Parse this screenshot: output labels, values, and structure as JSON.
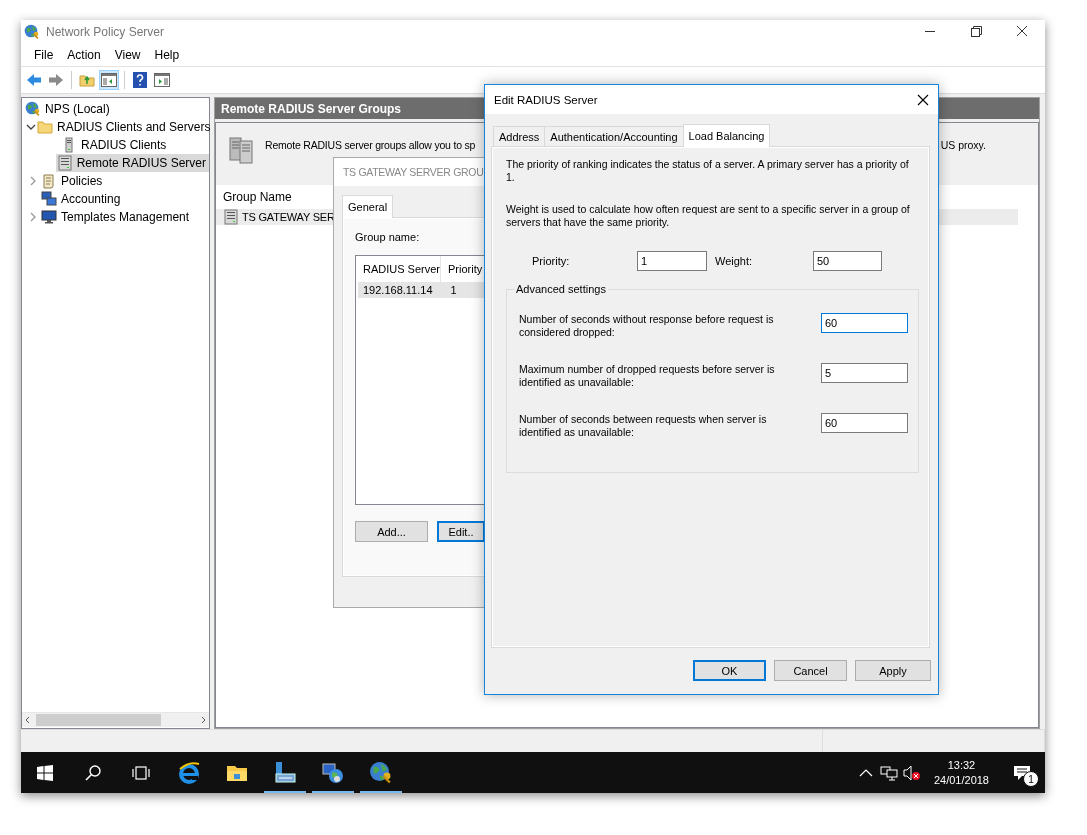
{
  "window": {
    "title": "Network Policy Server"
  },
  "menu": [
    "File",
    "Action",
    "View",
    "Help"
  ],
  "toolbar": {
    "console_tree_on": true
  },
  "tree": [
    {
      "label": "NPS (Local)",
      "kind": "root",
      "selected": false,
      "children": [
        {
          "label": "RADIUS Clients and Servers",
          "kind": "folder",
          "selected": false,
          "expanded": true,
          "children": [
            {
              "label": "RADIUS Clients",
              "kind": "client",
              "selected": false
            },
            {
              "label": "Remote RADIUS Server",
              "kind": "group",
              "selected": true
            }
          ]
        },
        {
          "label": "Policies",
          "kind": "policy",
          "selected": false,
          "expanded": false
        },
        {
          "label": "Accounting",
          "kind": "accounting",
          "selected": false
        },
        {
          "label": "Templates Management",
          "kind": "template",
          "selected": false,
          "expanded": false
        }
      ]
    }
  ],
  "pane": {
    "title": "Remote RADIUS Server Groups",
    "description_left": "Remote RADIUS server groups allow you to sp",
    "description_right": "US proxy.",
    "columns": [
      "Group Name"
    ],
    "rows": [
      {
        "name": "TS GATEWAY SER",
        "selected": true
      }
    ]
  },
  "group_dialog": {
    "title": "TS GATEWAY SERVER GROU",
    "tabs": [
      {
        "label": "General",
        "selected": true
      }
    ],
    "group_name_label": "Group name:",
    "columns": [
      "RADIUS Server",
      "Priority"
    ],
    "rows": [
      {
        "cells": [
          "192.168.11.14",
          "1"
        ],
        "selected": true
      }
    ],
    "buttons": [
      {
        "label": "Add...",
        "focused": false
      },
      {
        "label": "Edit..",
        "focused": true
      }
    ]
  },
  "edit_dialog": {
    "title": "Edit RADIUS Server",
    "tabs": [
      {
        "label": "Address",
        "selected": false
      },
      {
        "label": "Authentication/Accounting",
        "selected": false
      },
      {
        "label": "Load Balancing",
        "selected": true
      }
    ],
    "paragraphs": [
      "The priority of ranking indicates the status of a server. A primary server has a priority of 1.",
      "Weight is used to calculate how often request are sent to a specific server in a group of servers that have the same priority."
    ],
    "priority_label": "Priority:",
    "priority_value": "1",
    "weight_label": "Weight:",
    "weight_value": "50",
    "group_title": "Advanced settings",
    "settings": [
      {
        "label": "Number of seconds without response before request is considered dropped:",
        "value": "60",
        "focused": true
      },
      {
        "label": "Maximum number of dropped requests before server is identified as unavailable:",
        "value": "5",
        "focused": false
      },
      {
        "label": "Number of seconds between requests when server is identified as unavailable:",
        "value": "60",
        "focused": false
      }
    ],
    "buttons": [
      {
        "label": "OK",
        "focused": true
      },
      {
        "label": "Cancel",
        "focused": false
      },
      {
        "label": "Apply",
        "focused": false
      }
    ]
  },
  "taskbar": {
    "apps": [
      {
        "kind": "browser",
        "running": false
      },
      {
        "kind": "explorer",
        "running": false
      },
      {
        "kind": "server_manager",
        "running": true
      },
      {
        "kind": "network",
        "running": true
      },
      {
        "kind": "nps",
        "running": true
      }
    ],
    "time": "13:32",
    "date": "24/01/2018",
    "notifications": "1"
  }
}
